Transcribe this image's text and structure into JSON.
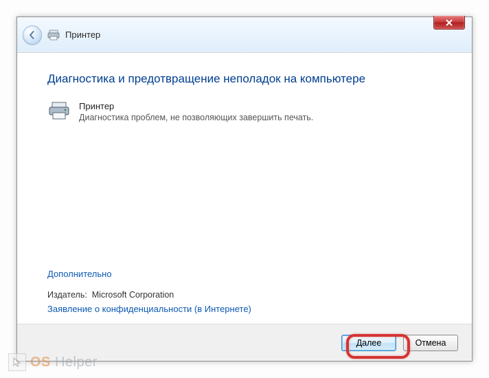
{
  "header": {
    "title": "Принтер"
  },
  "content": {
    "heading": "Диагностика и предотвращение неполадок на компьютере",
    "item": {
      "title": "Принтер",
      "description": "Диагностика проблем, не позволяющих завершить печать."
    },
    "advanced_link": "Дополнительно",
    "publisher_label": "Издатель:",
    "publisher_value": "Microsoft Corporation",
    "privacy_link": "Заявление о конфиденциальности (в Интернете)"
  },
  "footer": {
    "next": "Далее",
    "cancel": "Отмена"
  },
  "watermark": {
    "a": "OS",
    "b": "Helper"
  }
}
